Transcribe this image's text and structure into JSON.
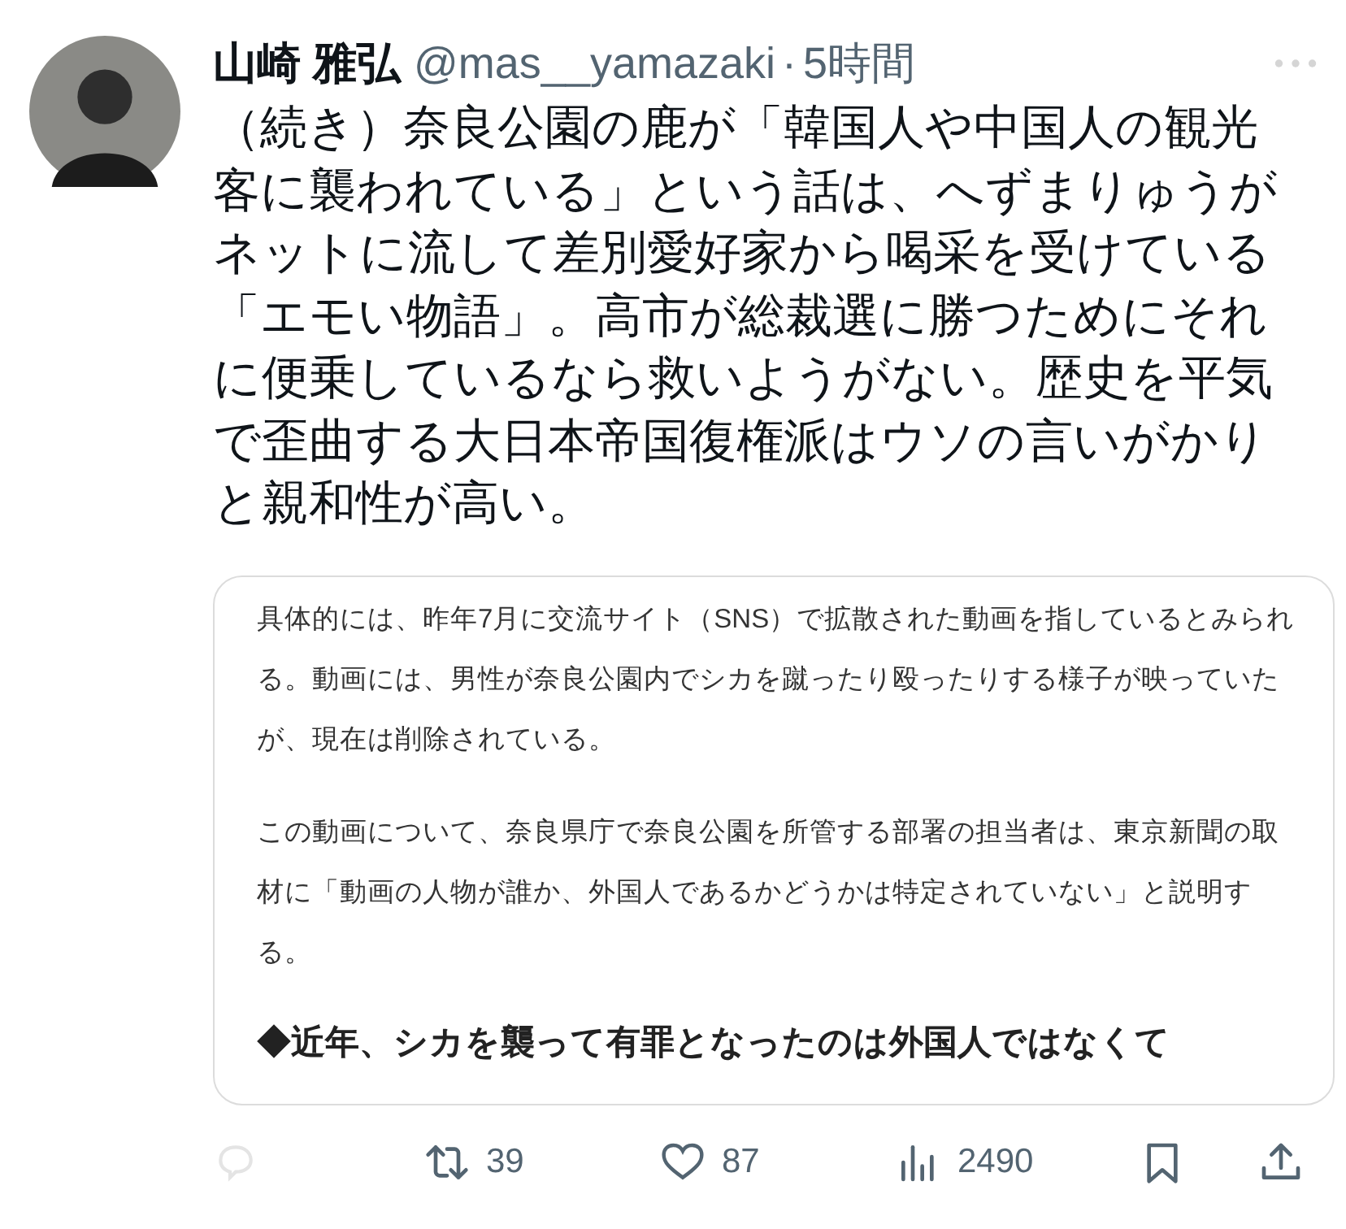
{
  "author": {
    "name": "山崎 雅弘",
    "handle": "@mas__yamazaki",
    "separator": "·",
    "time": "5時間"
  },
  "body": "（続き）奈良公園の鹿が「韓国人や中国人の観光客に襲われている」という話は、へずまりゅうがネットに流して差別愛好家から喝采を受けている「エモい物語」。高市が総裁選に勝つためにそれに便乗しているなら救いようがない。歴史を平気で歪曲する大日本帝国復権派はウソの言いがかりと親和性が高い。",
  "attachment": {
    "paragraphs": [
      "具体的には、昨年7月に交流サイト（SNS）で拡散された動画を指しているとみられる。動画には、男性が奈良公園内でシカを蹴ったり殴ったりする様子が映っていたが、現在は削除されている。",
      "この動画について、奈良県庁で奈良公園を所管する部署の担当者は、東京新聞の取材に「動画の人物が誰か、外国人であるかどうかは特定されていない」と説明する。"
    ],
    "heading": "◆近年、シカを襲って有罪となったのは外国人ではなくて"
  },
  "actions": [
    {
      "kind": "reply"
    },
    {
      "kind": "repost",
      "count": "39"
    },
    {
      "kind": "like",
      "count": "87"
    },
    {
      "kind": "views",
      "count": "2490"
    },
    {
      "kind": "bookmark"
    },
    {
      "kind": "share"
    }
  ]
}
